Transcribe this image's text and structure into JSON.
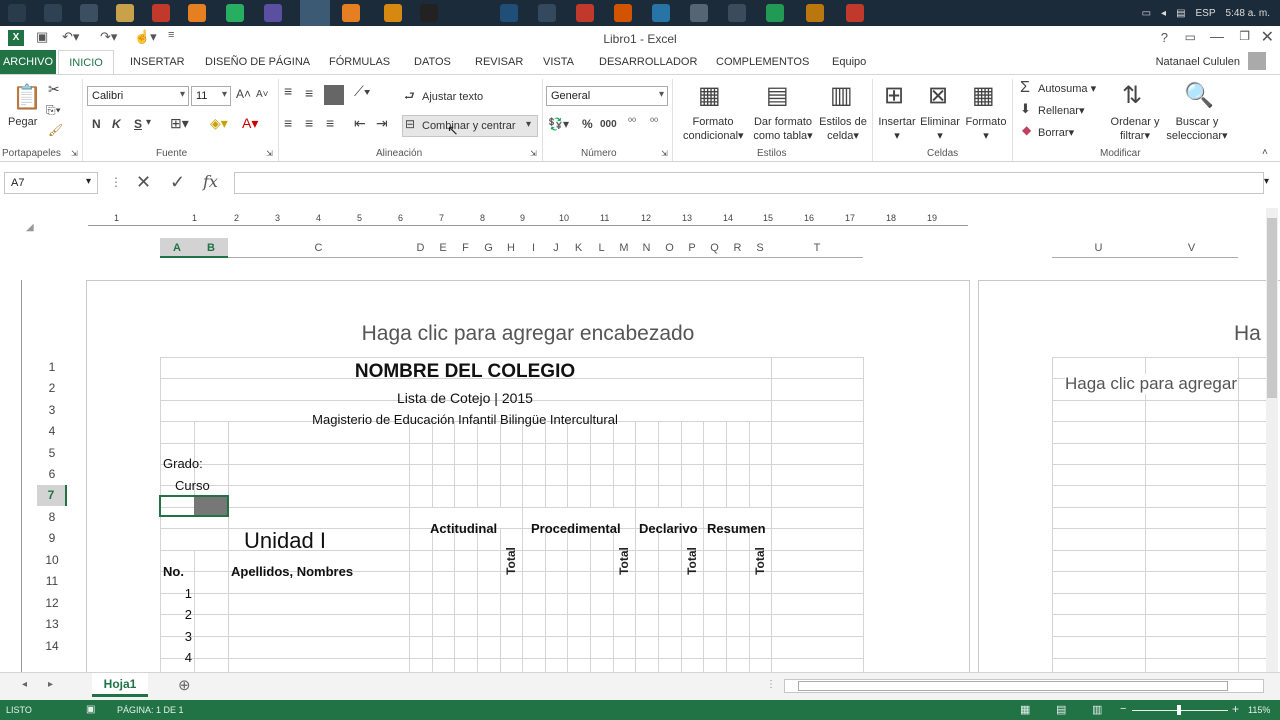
{
  "taskbar": {
    "lang": "ESP",
    "time": "5:48 a. m."
  },
  "window": {
    "title": "Libro1 - Excel",
    "user": "Natanael Cululen"
  },
  "tabs": [
    "ARCHIVO",
    "INICIO",
    "INSERTAR",
    "DISEÑO DE PÁGINA",
    "FÓRMULAS",
    "DATOS",
    "REVISAR",
    "VISTA",
    "DESARROLLADOR",
    "COMPLEMENTOS",
    "Equipo"
  ],
  "ribbon": {
    "paste": "Pegar",
    "font_name": "Calibri",
    "font_size": "11",
    "bold": "N",
    "italic": "K",
    "underline": "S",
    "wrap_text": "Ajustar texto",
    "merge_center": "Combinar y centrar",
    "number_format": "General",
    "cond_format_1": "Formato",
    "cond_format_2": "condicional",
    "table_format_1": "Dar formato",
    "table_format_2": "como tabla",
    "cell_styles_1": "Estilos de",
    "cell_styles_2": "celda",
    "insert": "Insertar",
    "delete": "Eliminar",
    "format": "Formato",
    "autosum": "Autosuma",
    "fill": "Rellenar",
    "clear": "Borrar",
    "sort_1": "Ordenar y",
    "sort_2": "filtrar",
    "find_1": "Buscar y",
    "find_2": "seleccionar",
    "groups": [
      "Portapapeles",
      "Fuente",
      "Alineación",
      "Número",
      "Estilos",
      "Celdas",
      "Modificar"
    ]
  },
  "formula_bar": {
    "name_box": "A7",
    "value": ""
  },
  "columns": [
    "A",
    "B",
    "C",
    "D",
    "E",
    "F",
    "G",
    "H",
    "I",
    "J",
    "K",
    "L",
    "M",
    "N",
    "O",
    "P",
    "Q",
    "R",
    "S",
    "T",
    "U",
    "V"
  ],
  "rows": [
    "1",
    "2",
    "3",
    "4",
    "5",
    "6",
    "7",
    "8",
    "9",
    "10",
    "11",
    "12",
    "13",
    "14"
  ],
  "header_placeholder": "Haga clic para agregar encabezado",
  "header_placeholder_right_1": "Ha",
  "header_placeholder_right_2": "Haga clic para agregar",
  "cells": {
    "school": "NOMBRE DEL COLEGIO",
    "list": "Lista de Cotejo | 2015",
    "program": "Magisterio de Educación Infantil Bilingüe Intercultural",
    "grade": "Grado:",
    "course": "Curso",
    "unit": "Unidad I",
    "attitudinal": "Actitudinal",
    "procedural": "Procedimental",
    "declarative": "Declarivo",
    "summary": "Resumen",
    "total": "Total",
    "no": "No.",
    "names": "Apellidos, Nombres",
    "n1": "1",
    "n2": "2",
    "n3": "3",
    "n4": "4"
  },
  "sheet_tab": "Hoja1",
  "status": {
    "left": "LISTO",
    "page": "PÁGINA: 1 DE 1",
    "zoom": "115%"
  },
  "ruler_numbers": [
    "1",
    "1",
    "2",
    "3",
    "4",
    "5",
    "6",
    "7",
    "8",
    "9",
    "10",
    "11",
    "12",
    "13",
    "14",
    "15",
    "16",
    "17",
    "18",
    "19"
  ]
}
